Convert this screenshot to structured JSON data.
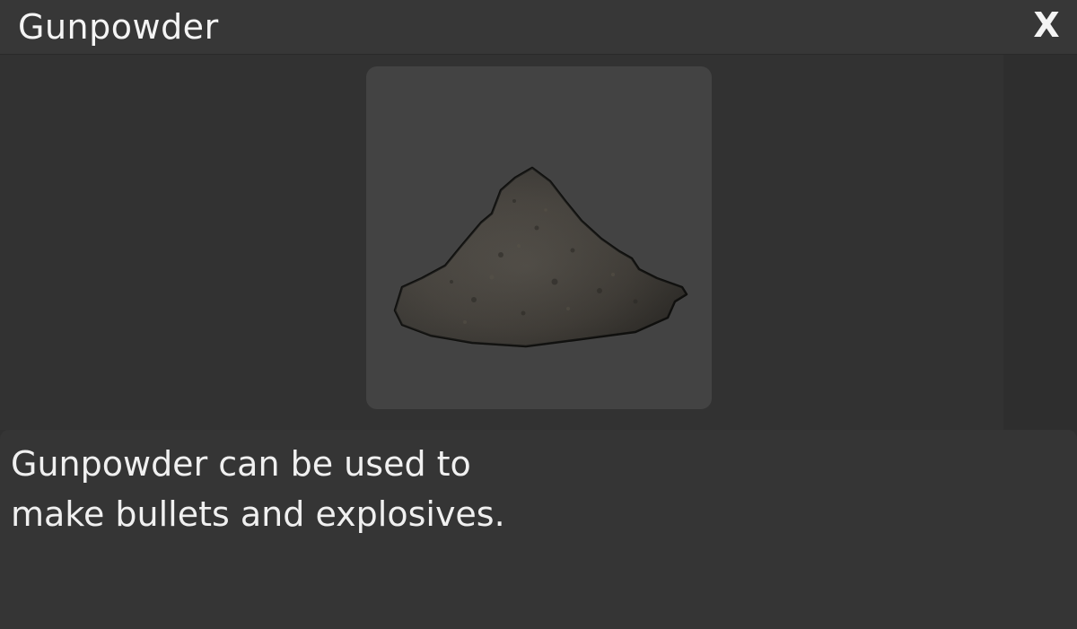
{
  "window": {
    "title": "Gunpowder",
    "close_label": "X"
  },
  "item": {
    "icon": "gunpowder-pile-icon",
    "description": "Gunpowder can be used to make bullets and explosives."
  },
  "colors": {
    "background": "#303030",
    "titlebar": "#373737",
    "item_frame": "#434343",
    "text": "#f0f0f0"
  }
}
